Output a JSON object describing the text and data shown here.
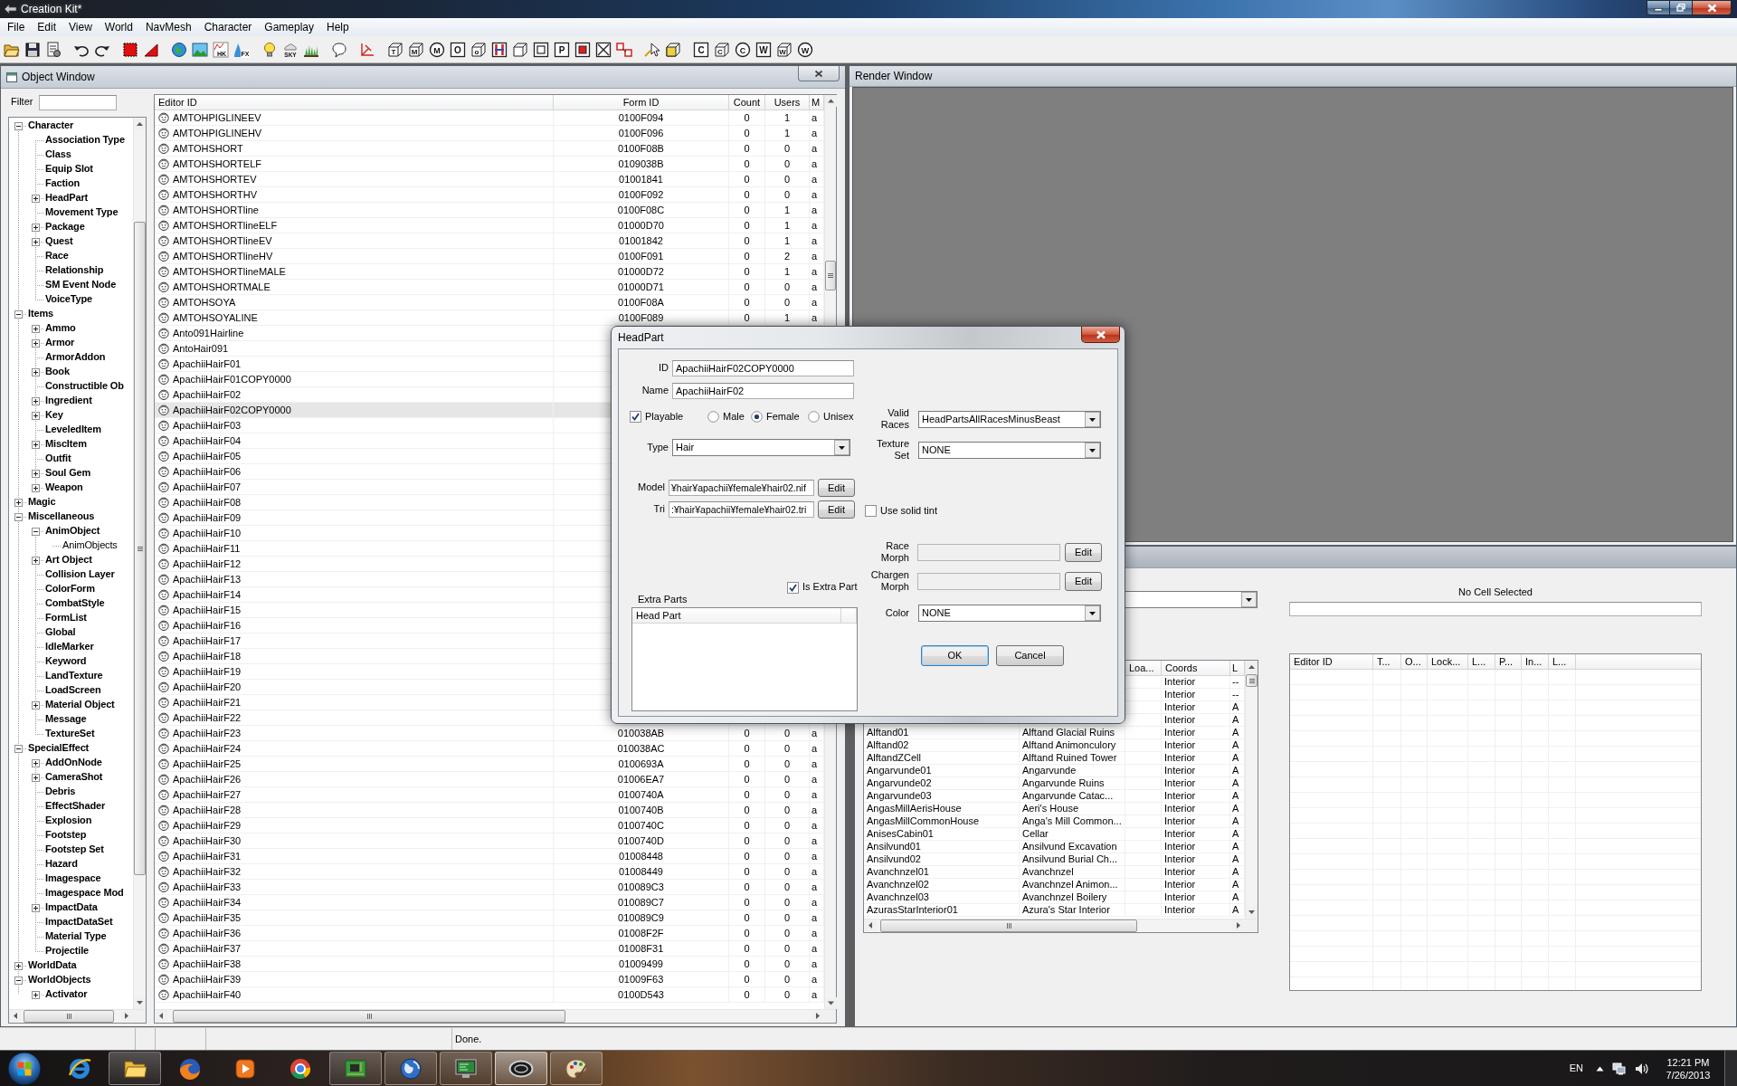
{
  "window": {
    "title": "Creation Kit*"
  },
  "menu": [
    "File",
    "Edit",
    "View",
    "World",
    "NavMesh",
    "Character",
    "Gameplay",
    "Help"
  ],
  "toolbar": [
    [
      {
        "kind": "folder"
      },
      {
        "kind": "disk"
      },
      {
        "kind": "sheet"
      }
    ],
    [
      {
        "kind": "undo"
      },
      {
        "kind": "redo"
      }
    ],
    [
      {
        "kind": "marquee"
      },
      {
        "kind": "wedge"
      }
    ],
    [
      {
        "kind": "globe"
      },
      {
        "kind": "picture"
      },
      {
        "kind": "graph",
        "glyph": "HK"
      },
      {
        "kind": "splash",
        "glyph": "FX"
      }
    ],
    [
      {
        "kind": "bulb"
      },
      {
        "kind": "cloud",
        "glyph": "SKY"
      },
      {
        "kind": "grass"
      }
    ],
    [
      {
        "kind": "bubble"
      }
    ],
    [
      {
        "kind": "axes"
      }
    ],
    [
      {
        "kind": "cube",
        "glyph": "T"
      },
      {
        "kind": "cube",
        "glyph": "M"
      },
      {
        "kind": "ring",
        "glyph": "M"
      },
      {
        "kind": "square",
        "glyph": "O"
      },
      {
        "kind": "cube",
        "glyph": "o"
      },
      {
        "kind": "hbars"
      },
      {
        "kind": "cube"
      },
      {
        "kind": "nested"
      },
      {
        "kind": "square",
        "glyph": "P"
      },
      {
        "kind": "redbox"
      },
      {
        "kind": "crossbox"
      },
      {
        "kind": "chain"
      }
    ],
    [
      {
        "kind": "pointer"
      },
      {
        "kind": "halfcube"
      }
    ],
    [
      {
        "kind": "square",
        "glyph": "C"
      },
      {
        "kind": "cube",
        "glyph": "C"
      },
      {
        "kind": "ring",
        "glyph": "C"
      },
      {
        "kind": "square",
        "glyph": "W"
      },
      {
        "kind": "cube",
        "glyph": "W"
      },
      {
        "kind": "ring",
        "glyph": "W"
      }
    ]
  ],
  "object_window": {
    "title": "Object Window",
    "filter_label": "Filter",
    "tree": [
      {
        "label": "Character",
        "expanded": true,
        "children": [
          {
            "label": "Association Type"
          },
          {
            "label": "Class"
          },
          {
            "label": "Equip Slot"
          },
          {
            "label": "Faction"
          },
          {
            "label": "HeadPart",
            "expanded": false
          },
          {
            "label": "Movement Type"
          },
          {
            "label": "Package",
            "expanded": false
          },
          {
            "label": "Quest",
            "expanded": false
          },
          {
            "label": "Race"
          },
          {
            "label": "Relationship"
          },
          {
            "label": "SM Event Node"
          },
          {
            "label": "VoiceType"
          }
        ]
      },
      {
        "label": "Items",
        "expanded": true,
        "children": [
          {
            "label": "Ammo",
            "expanded": false
          },
          {
            "label": "Armor",
            "expanded": false
          },
          {
            "label": "ArmorAddon"
          },
          {
            "label": "Book",
            "expanded": false
          },
          {
            "label": "Constructible Ob"
          },
          {
            "label": "Ingredient",
            "expanded": false
          },
          {
            "label": "Key",
            "expanded": false
          },
          {
            "label": "LeveledItem"
          },
          {
            "label": "MiscItem",
            "expanded": false
          },
          {
            "label": "Outfit"
          },
          {
            "label": "Soul Gem",
            "expanded": false
          },
          {
            "label": "Weapon",
            "expanded": false
          }
        ]
      },
      {
        "label": "Magic",
        "expanded": false
      },
      {
        "label": "Miscellaneous",
        "expanded": true,
        "children": [
          {
            "label": "AnimObject",
            "expanded": true,
            "children": [
              {
                "label": "AnimObjects"
              }
            ]
          },
          {
            "label": "Art Object",
            "expanded": false
          },
          {
            "label": "Collision Layer"
          },
          {
            "label": "ColorForm"
          },
          {
            "label": "CombatStyle"
          },
          {
            "label": "FormList"
          },
          {
            "label": "Global"
          },
          {
            "label": "IdleMarker"
          },
          {
            "label": "Keyword"
          },
          {
            "label": "LandTexture"
          },
          {
            "label": "LoadScreen"
          },
          {
            "label": "Material Object",
            "expanded": false
          },
          {
            "label": "Message"
          },
          {
            "label": "TextureSet"
          }
        ]
      },
      {
        "label": "SpecialEffect",
        "expanded": true,
        "children": [
          {
            "label": "AddOnNode",
            "expanded": false
          },
          {
            "label": "CameraShot",
            "expanded": false
          },
          {
            "label": "Debris"
          },
          {
            "label": "EffectShader"
          },
          {
            "label": "Explosion"
          },
          {
            "label": "Footstep"
          },
          {
            "label": "Footstep Set"
          },
          {
            "label": "Hazard"
          },
          {
            "label": "Imagespace"
          },
          {
            "label": "Imagespace Mod"
          },
          {
            "label": "ImpactData",
            "expanded": false
          },
          {
            "label": "ImpactDataSet"
          },
          {
            "label": "Material Type"
          },
          {
            "label": "Projectile"
          }
        ]
      },
      {
        "label": "WorldData",
        "expanded": false
      },
      {
        "label": "WorldObjects",
        "expanded": true,
        "children": [
          {
            "label": "Activator",
            "expanded": false
          }
        ]
      }
    ],
    "columns": [
      "Editor ID",
      "Form ID",
      "Count",
      "Users",
      "M"
    ],
    "rows": [
      {
        "cells": [
          "AMTOHPIGLINEEV",
          "0100F094",
          "0",
          "1",
          "a"
        ],
        "selected": false
      },
      {
        "cells": [
          "AMTOHPIGLINEHV",
          "0100F096",
          "0",
          "1",
          "a"
        ],
        "selected": false
      },
      {
        "cells": [
          "AMTOHSHORT",
          "0100F08B",
          "0",
          "0",
          "a"
        ],
        "selected": false
      },
      {
        "cells": [
          "AMTOHSHORTELF",
          "0109038B",
          "0",
          "0",
          "a"
        ],
        "selected": false
      },
      {
        "cells": [
          "AMTOHSHORTEV",
          "01001841",
          "0",
          "0",
          "a"
        ],
        "selected": false
      },
      {
        "cells": [
          "AMTOHSHORTHV",
          "0100F092",
          "0",
          "0",
          "a"
        ],
        "selected": false
      },
      {
        "cells": [
          "AMTOHSHORTline",
          "0100F08C",
          "0",
          "1",
          "a"
        ],
        "selected": false
      },
      {
        "cells": [
          "AMTOHSHORTlineELF",
          "01000D70",
          "0",
          "1",
          "a"
        ],
        "selected": false
      },
      {
        "cells": [
          "AMTOHSHORTlineEV",
          "01001842",
          "0",
          "1",
          "a"
        ],
        "selected": false
      },
      {
        "cells": [
          "AMTOHSHORTlineHV",
          "0100F091",
          "0",
          "2",
          "a"
        ],
        "selected": false
      },
      {
        "cells": [
          "AMTOHSHORTlineMALE",
          "01000D72",
          "0",
          "1",
          "a"
        ],
        "selected": false
      },
      {
        "cells": [
          "AMTOHSHORTMALE",
          "01000D71",
          "0",
          "0",
          "a"
        ],
        "selected": false
      },
      {
        "cells": [
          "AMTOHSOYA",
          "0100F08A",
          "0",
          "0",
          "a"
        ],
        "selected": false
      },
      {
        "cells": [
          "AMTOHSOYALINE",
          "0100F089",
          "0",
          "1",
          "a"
        ],
        "selected": false
      },
      {
        "cells": [
          "Anto091Hairline"
        ],
        "selected": false
      },
      {
        "cells": [
          "AntoHair091"
        ],
        "selected": false
      },
      {
        "cells": [
          "ApachiiHairF01"
        ],
        "selected": false
      },
      {
        "cells": [
          "ApachiiHairF01COPY0000"
        ],
        "selected": false
      },
      {
        "cells": [
          "ApachiiHairF02"
        ],
        "selected": false
      },
      {
        "cells": [
          "ApachiiHairF02COPY0000"
        ],
        "selected": true
      },
      {
        "cells": [
          "ApachiiHairF03"
        ],
        "selected": false
      },
      {
        "cells": [
          "ApachiiHairF04"
        ],
        "selected": false
      },
      {
        "cells": [
          "ApachiiHairF05"
        ],
        "selected": false
      },
      {
        "cells": [
          "ApachiiHairF06"
        ],
        "selected": false
      },
      {
        "cells": [
          "ApachiiHairF07"
        ],
        "selected": false
      },
      {
        "cells": [
          "ApachiiHairF08"
        ],
        "selected": false
      },
      {
        "cells": [
          "ApachiiHairF09"
        ],
        "selected": false
      },
      {
        "cells": [
          "ApachiiHairF10"
        ],
        "selected": false
      },
      {
        "cells": [
          "ApachiiHairF11"
        ],
        "selected": false
      },
      {
        "cells": [
          "ApachiiHairF12"
        ],
        "selected": false
      },
      {
        "cells": [
          "ApachiiHairF13"
        ],
        "selected": false
      },
      {
        "cells": [
          "ApachiiHairF14"
        ],
        "selected": false
      },
      {
        "cells": [
          "ApachiiHairF15"
        ],
        "selected": false
      },
      {
        "cells": [
          "ApachiiHairF16"
        ],
        "selected": false
      },
      {
        "cells": [
          "ApachiiHairF17"
        ],
        "selected": false
      },
      {
        "cells": [
          "ApachiiHairF18"
        ],
        "selected": false
      },
      {
        "cells": [
          "ApachiiHairF19"
        ],
        "selected": false
      },
      {
        "cells": [
          "ApachiiHairF20"
        ],
        "selected": false
      },
      {
        "cells": [
          "ApachiiHairF21"
        ],
        "selected": false
      },
      {
        "cells": [
          "ApachiiHairF22"
        ],
        "selected": false
      },
      {
        "cells": [
          "ApachiiHairF23",
          "010038AB",
          "0",
          "0",
          "a"
        ],
        "selected": false
      },
      {
        "cells": [
          "ApachiiHairF24",
          "010038AC",
          "0",
          "0",
          "a"
        ],
        "selected": false
      },
      {
        "cells": [
          "ApachiiHairF25",
          "0100693A",
          "0",
          "0",
          "a"
        ],
        "selected": false
      },
      {
        "cells": [
          "ApachiiHairF26",
          "01006EA7",
          "0",
          "0",
          "a"
        ],
        "selected": false
      },
      {
        "cells": [
          "ApachiiHairF27",
          "0100740A",
          "0",
          "0",
          "a"
        ],
        "selected": false
      },
      {
        "cells": [
          "ApachiiHairF28",
          "0100740B",
          "0",
          "0",
          "a"
        ],
        "selected": false
      },
      {
        "cells": [
          "ApachiiHairF29",
          "0100740C",
          "0",
          "0",
          "a"
        ],
        "selected": false
      },
      {
        "cells": [
          "ApachiiHairF30",
          "0100740D",
          "0",
          "0",
          "a"
        ],
        "selected": false
      },
      {
        "cells": [
          "ApachiiHairF31",
          "01008448",
          "0",
          "0",
          "a"
        ],
        "selected": false
      },
      {
        "cells": [
          "ApachiiHairF32",
          "01008449",
          "0",
          "0",
          "a"
        ],
        "selected": false
      },
      {
        "cells": [
          "ApachiiHairF33",
          "010089C3",
          "0",
          "0",
          "a"
        ],
        "selected": false
      },
      {
        "cells": [
          "ApachiiHairF34",
          "010089C7",
          "0",
          "0",
          "a"
        ],
        "selected": false
      },
      {
        "cells": [
          "ApachiiHairF35",
          "010089C9",
          "0",
          "0",
          "a"
        ],
        "selected": false
      },
      {
        "cells": [
          "ApachiiHairF36",
          "01008F2F",
          "0",
          "0",
          "a"
        ],
        "selected": false
      },
      {
        "cells": [
          "ApachiiHairF37",
          "01008F31",
          "0",
          "0",
          "a"
        ],
        "selected": false
      },
      {
        "cells": [
          "ApachiiHairF38",
          "01009499",
          "0",
          "0",
          "a"
        ],
        "selected": false
      },
      {
        "cells": [
          "ApachiiHairF39",
          "01009F63",
          "0",
          "0",
          "a"
        ],
        "selected": false
      },
      {
        "cells": [
          "ApachiiHairF40",
          "0100D543",
          "0",
          "0",
          "a"
        ],
        "selected": false
      }
    ]
  },
  "render_window": {
    "title": "Render Window"
  },
  "cell_view": {
    "status": "No Cell Selected",
    "cell_columns": [
      {},
      {},
      {
        "label": "Loa..."
      },
      {
        "label": "Coords"
      },
      {
        "label": "L"
      }
    ],
    "cell_rows": [
      {
        "cells": [
          null,
          null,
          null,
          "Interior",
          "--"
        ]
      },
      {
        "cells": [
          null,
          null,
          null,
          "Interior",
          "--"
        ]
      },
      {
        "cells": [
          null,
          null,
          null,
          "Interior",
          "A"
        ]
      },
      {
        "cells": [
          null,
          null,
          null,
          "Interior",
          "A"
        ]
      },
      {
        "cells": [
          "Alftand01",
          "Alftand Glacial Ruins",
          null,
          "Interior",
          "A"
        ]
      },
      {
        "cells": [
          "Alftand02",
          "Alftand Animonculory",
          null,
          "Interior",
          "A"
        ]
      },
      {
        "cells": [
          "AlftandZCell",
          "Alftand Ruined Tower",
          null,
          "Interior",
          "A"
        ]
      },
      {
        "cells": [
          "Angarvunde01",
          "Angarvunde",
          null,
          "Interior",
          "A"
        ]
      },
      {
        "cells": [
          "Angarvunde02",
          "Angarvunde Ruins",
          null,
          "Interior",
          "A"
        ]
      },
      {
        "cells": [
          "Angarvunde03",
          "Angarvunde Catac...",
          null,
          "Interior",
          "A"
        ]
      },
      {
        "cells": [
          "AngasMillAerisHouse",
          "Aeri's House",
          null,
          "Interior",
          "A"
        ]
      },
      {
        "cells": [
          "AngasMillCommonHouse",
          "Anga's Mill Common...",
          null,
          "Interior",
          "A"
        ]
      },
      {
        "cells": [
          "AnisesCabin01",
          "Cellar",
          null,
          "Interior",
          "A"
        ]
      },
      {
        "cells": [
          "Ansilvund01",
          "Ansilvund Excavation",
          null,
          "Interior",
          "A"
        ]
      },
      {
        "cells": [
          "Ansilvund02",
          "Ansilvund Burial Ch...",
          null,
          "Interior",
          "A"
        ]
      },
      {
        "cells": [
          "Avanchnzel01",
          "Avanchnzel",
          null,
          "Interior",
          "A"
        ]
      },
      {
        "cells": [
          "Avanchnzel02",
          "Avanchnzel Animon...",
          null,
          "Interior",
          "A"
        ]
      },
      {
        "cells": [
          "Avanchnzel03",
          "Avanchnzel Boilery",
          null,
          "Interior",
          "A"
        ]
      },
      {
        "cells": [
          "AzurasStarInterior01",
          "Azura's Star Interior",
          null,
          "Interior",
          "A"
        ]
      }
    ],
    "reference_columns": [
      "Editor ID",
      "T...",
      "O...",
      "Lock...",
      "L...",
      "P...",
      "In...",
      "L..."
    ]
  },
  "dialog": {
    "title": "HeadPart",
    "id": {
      "label": "ID",
      "value": "ApachiiHairF02COPY0000"
    },
    "name": {
      "label": "Name",
      "value": "ApachiiHairF02"
    },
    "playable": {
      "label": "Playable",
      "checked": true
    },
    "sex": [
      {
        "label": "Male",
        "selected": false
      },
      {
        "label": "Female",
        "selected": true
      },
      {
        "label": "Unisex",
        "selected": false
      }
    ],
    "type": {
      "label": "Type",
      "value": "Hair"
    },
    "model": {
      "label": "Model",
      "value": "¥hair¥apachii¥female¥hair02.nif",
      "button": "Edit"
    },
    "tri": {
      "label": "Tri",
      "value": ":¥hair¥apachii¥female¥hair02.tri",
      "button": "Edit"
    },
    "is_extra_part": {
      "label": "Is Extra Part",
      "checked": true
    },
    "extra_parts": {
      "label": "Extra Parts",
      "columns": [
        "Head Part"
      ]
    },
    "valid_races": {
      "label": "Valid Races",
      "value": "HeadPartsAllRacesMinusBeast"
    },
    "texture_set": {
      "label": "Texture Set",
      "value": "NONE"
    },
    "use_solid_tint": {
      "label": "Use solid tint",
      "checked": false
    },
    "race_morph": {
      "label": "Race Morph",
      "button": "Edit",
      "disabled": true
    },
    "chargen_morph": {
      "label": "Chargen Morph",
      "button": "Edit",
      "disabled": true
    },
    "color": {
      "label": "Color",
      "value": "NONE"
    },
    "buttons": [
      "OK",
      "Cancel"
    ]
  },
  "status_bar": {
    "text": "Done."
  },
  "taskbar": {
    "apps": [
      {
        "kind": "ebrowser",
        "running": false,
        "selected": false
      },
      {
        "kind": "folder",
        "running": true,
        "selected": false
      },
      {
        "kind": "fox",
        "running": false,
        "selected": false
      },
      {
        "kind": "player",
        "running": false,
        "selected": false
      },
      {
        "kind": "wheel",
        "running": false,
        "selected": false
      },
      {
        "kind": "board",
        "running": true,
        "selected": false
      },
      {
        "kind": "globe",
        "running": true,
        "selected": false
      },
      {
        "kind": "monitor",
        "running": true,
        "selected": false
      },
      {
        "kind": "emblem",
        "running": true,
        "selected": true
      },
      {
        "kind": "palette",
        "running": true,
        "selected": false
      }
    ],
    "language": "EN",
    "time": "12:21 PM",
    "date": "7/26/2013"
  }
}
